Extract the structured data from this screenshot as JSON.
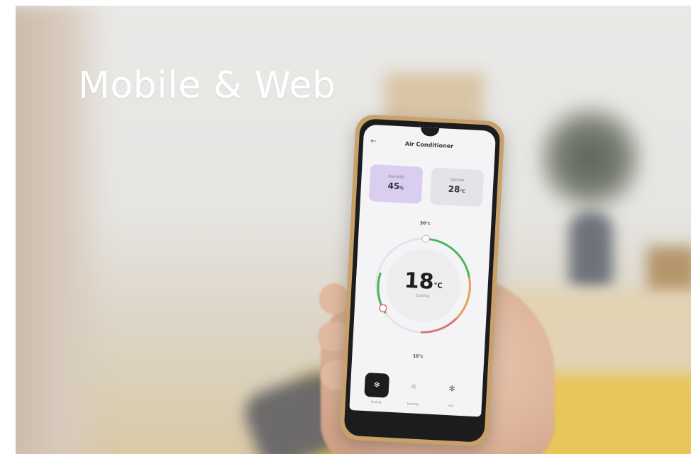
{
  "headline": "Mobile & Web",
  "app": {
    "back_icon": "arrow-left-icon",
    "title": "Air Conditioner",
    "cards": {
      "humidity": {
        "label": "Humidity",
        "value": "45",
        "unit": "%"
      },
      "outdoor": {
        "label": "Outdoor",
        "value": "28",
        "unit": "°C"
      }
    },
    "dial": {
      "max_label": "30°c",
      "min_label": "16°c",
      "temperature": "18",
      "unit": "°C",
      "mode_label": "Cooling",
      "colors": {
        "cool": "#4cb35e",
        "warm": "#e3a35b",
        "hot": "#d9747a"
      }
    },
    "modes": [
      {
        "label": "Cooling",
        "icon": "snowflake-icon",
        "active": true
      },
      {
        "label": "Heating",
        "icon": "sun-icon",
        "active": false
      },
      {
        "label": "Fan",
        "icon": "fan-icon",
        "active": false
      }
    ]
  }
}
